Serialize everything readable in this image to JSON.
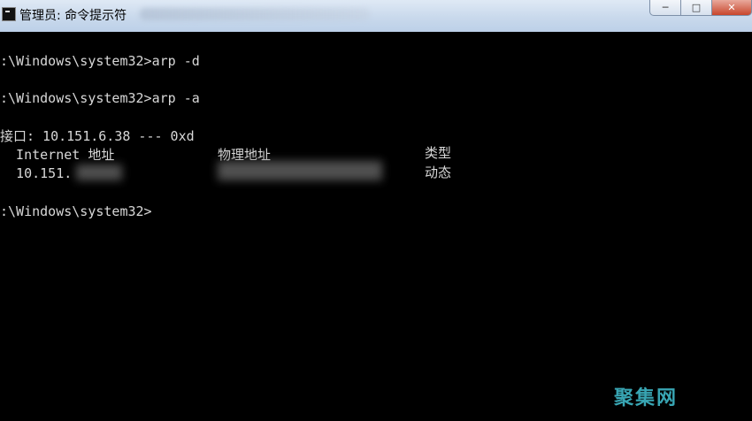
{
  "window": {
    "title": "管理员: 命令提示符",
    "controls": {
      "minimize": "─",
      "maximize": "□",
      "close": "✕"
    }
  },
  "console": {
    "lines": [
      ":\\Windows\\system32>arp -d",
      ":\\Windows\\system32>arp -a",
      "接口: 10.151.6.38 --- 0xd",
      "  Internet 地址",
      "  10.151.",
      ":\\Windows\\system32>"
    ],
    "columns": {
      "physical_address_header": "物理地址",
      "type_header": "类型",
      "type_value": "动态"
    }
  },
  "watermark": "聚集网",
  "colors": {
    "console_bg": "#000000",
    "console_text": "#d8d8d8",
    "titlebar": "#c9d9ec",
    "watermark": "#3fb7c7"
  }
}
